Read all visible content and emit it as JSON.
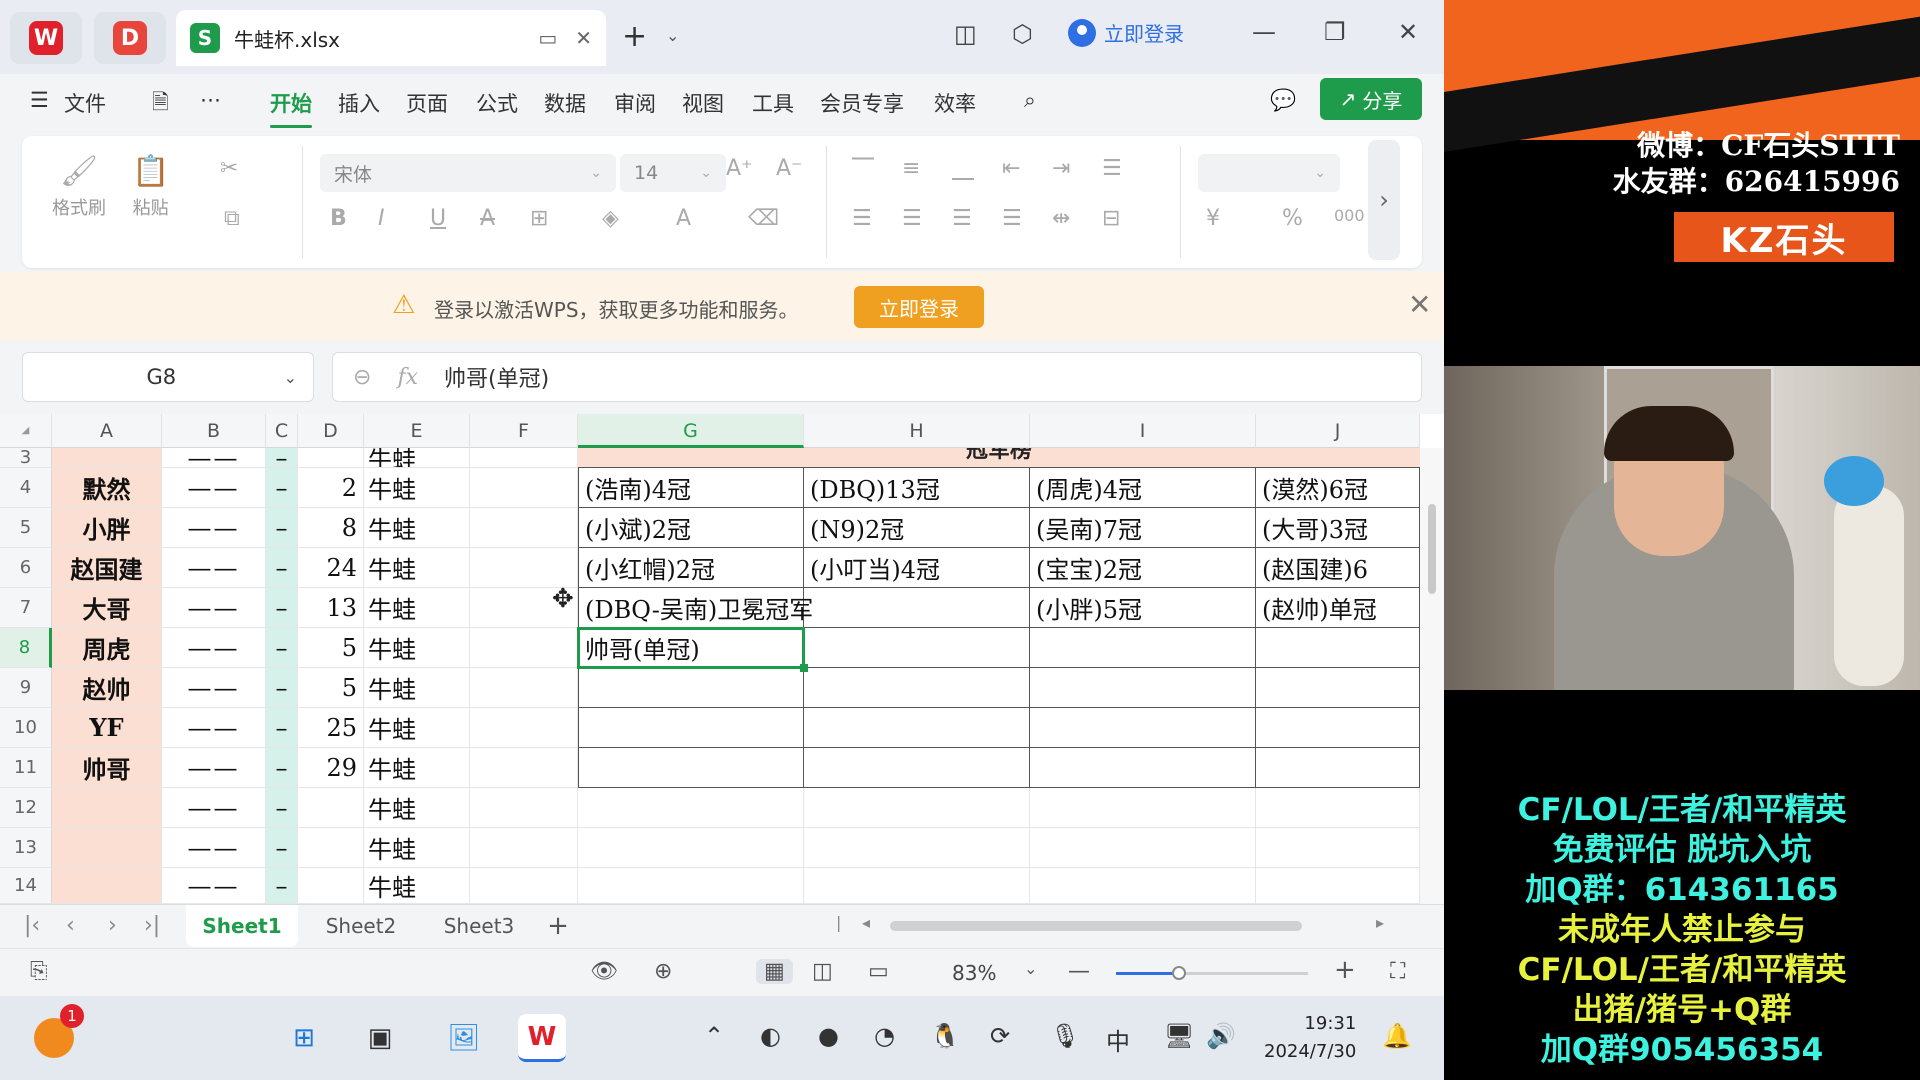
{
  "window": {
    "file_tab": "牛蛙杯.xlsx",
    "login_top": "立即登录"
  },
  "menu": {
    "items": [
      "文件",
      "开始",
      "插入",
      "页面",
      "公式",
      "数据",
      "审阅",
      "视图",
      "工具",
      "会员专享",
      "效率"
    ],
    "active": "开始",
    "share": "分享"
  },
  "ribbon": {
    "format_painter": "格式刷",
    "paste": "粘贴",
    "font_name": "宋体",
    "font_size": "14"
  },
  "notice": {
    "message": "登录以激活WPS，获取更多功能和服务。",
    "button": "立即登录"
  },
  "formula_bar": {
    "cell_ref": "G8",
    "content": "帅哥(单冠)"
  },
  "grid": {
    "columns": [
      "A",
      "B",
      "C",
      "D",
      "E",
      "F",
      "G",
      "H",
      "I",
      "J"
    ],
    "selected_column": "G",
    "selected_row": "8",
    "row_numbers": [
      "3",
      "4",
      "5",
      "6",
      "7",
      "8",
      "9",
      "10",
      "11",
      "12",
      "13",
      "14"
    ],
    "left_rows": [
      {
        "a": "",
        "b": "——",
        "c": "–",
        "d": "",
        "e": "牛蛙"
      },
      {
        "a": "默然",
        "b": "——",
        "c": "–",
        "d": "2",
        "e": "牛蛙"
      },
      {
        "a": "小胖",
        "b": "——",
        "c": "–",
        "d": "8",
        "e": "牛蛙"
      },
      {
        "a": "赵国建",
        "b": "——",
        "c": "–",
        "d": "24",
        "e": "牛蛙"
      },
      {
        "a": "大哥",
        "b": "——",
        "c": "–",
        "d": "13",
        "e": "牛蛙"
      },
      {
        "a": "周虎",
        "b": "——",
        "c": "–",
        "d": "5",
        "e": "牛蛙"
      },
      {
        "a": "赵帅",
        "b": "——",
        "c": "–",
        "d": "5",
        "e": "牛蛙"
      },
      {
        "a": "YF",
        "b": "——",
        "c": "–",
        "d": "25",
        "e": "牛蛙"
      },
      {
        "a": "帅哥",
        "b": "——",
        "c": "–",
        "d": "29",
        "e": "牛蛙"
      },
      {
        "a": "",
        "b": "——",
        "c": "–",
        "d": "",
        "e": "牛蛙"
      },
      {
        "a": "",
        "b": "——",
        "c": "–",
        "d": "",
        "e": "牛蛙"
      },
      {
        "a": "",
        "b": "——",
        "c": "–",
        "d": "",
        "e": "牛蛙"
      }
    ],
    "table_header": "冠军榜",
    "table_rows": [
      [
        "(浩南)4冠",
        "(DBQ)13冠",
        "(周虎)4冠",
        "(漠然)6冠"
      ],
      [
        "(小斌)2冠",
        "(N9)2冠",
        "(吴南)7冠",
        "(大哥)3冠"
      ],
      [
        "(小红帽)2冠",
        "(小叮当)4冠",
        "(宝宝)2冠",
        "(赵国建)6"
      ],
      [
        "(DBQ-吴南)卫冕冠军",
        "",
        "(小胖)5冠",
        "(赵帅)单冠"
      ],
      [
        "帅哥(单冠)",
        "",
        "",
        ""
      ],
      [
        "",
        "",
        "",
        ""
      ],
      [
        "",
        "",
        "",
        ""
      ],
      [
        "",
        "",
        "",
        ""
      ]
    ]
  },
  "sheets": {
    "tabs": [
      "Sheet1",
      "Sheet2",
      "Sheet3"
    ],
    "active": "Sheet1",
    "add": "+"
  },
  "status": {
    "zoom": "83%",
    "zoom_level": 0.33
  },
  "taskbar": {
    "badge": "1",
    "ime": "中",
    "time": "19:31",
    "date": "2024/7/30"
  },
  "overlay": {
    "weibo": "微博：CF石头STTT",
    "fan_group": "水友群：626415996",
    "streamer": "KZ石头",
    "promo": [
      {
        "text": "CF/LOL/王者/和平精英",
        "style": "cyan"
      },
      {
        "text": "免费评估  脱坑入坑",
        "style": "cyan"
      },
      {
        "text": "加Q群：614361165",
        "style": "cyan"
      },
      {
        "text": "未成年人禁止参与",
        "style": "yellow"
      },
      {
        "text": "CF/LOL/王者/和平精英",
        "style": "yellow"
      },
      {
        "text": "出猪/猪号+Q群",
        "style": "yellow"
      },
      {
        "text": "加Q群905456354",
        "style": "cyan"
      }
    ]
  },
  "colors": {
    "accent": "#1e9b4b",
    "name_column_fill": "#fbdfd2",
    "dash_column_fill": "#d5f1ea",
    "notice_button": "#f0a020",
    "overlay_orange": "#f0641e",
    "promo_cyan": "#3ef2e0",
    "promo_yellow": "#e6f23e"
  }
}
